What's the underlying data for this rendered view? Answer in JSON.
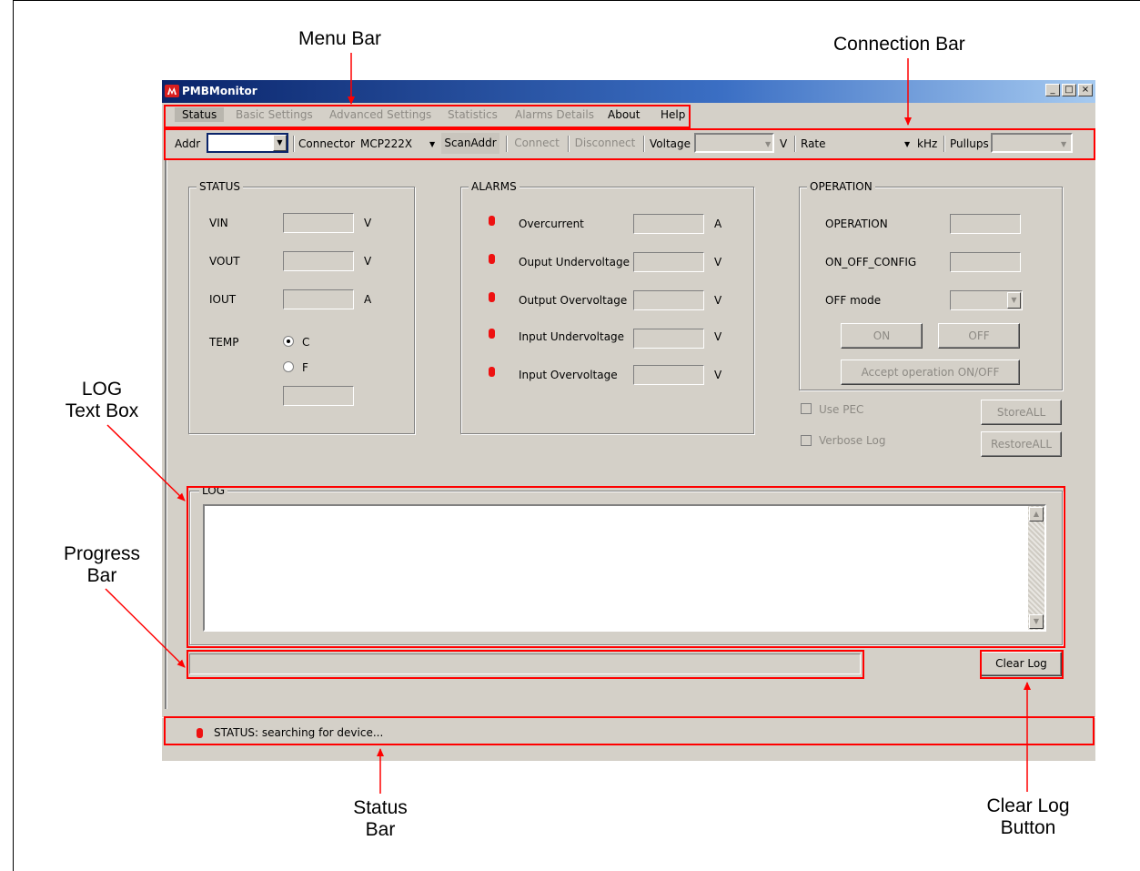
{
  "annotations": {
    "menu_bar": "Menu Bar",
    "connection_bar": "Connection Bar",
    "log_text_box_1": "LOG",
    "log_text_box_2": "Text Box",
    "progress_bar_1": "Progress",
    "progress_bar_2": "Bar",
    "status_bar_1": "Status",
    "status_bar_2": "Bar",
    "clear_log_1": "Clear Log",
    "clear_log_2": "Button"
  },
  "window": {
    "title": "PMBMonitor",
    "btn_minimize": "_",
    "btn_maximize": "□",
    "btn_close": "×"
  },
  "menu": {
    "items": [
      {
        "label": "Status",
        "state": "selected"
      },
      {
        "label": "Basic Settings",
        "state": "disabled"
      },
      {
        "label": "Advanced Settings",
        "state": "disabled"
      },
      {
        "label": "Statistics",
        "state": "disabled"
      },
      {
        "label": "Alarms Details",
        "state": "disabled"
      },
      {
        "label": "About",
        "state": "enabled"
      },
      {
        "label": "Help",
        "state": "enabled"
      }
    ]
  },
  "connection": {
    "addr_label": "Addr",
    "addr_value": "",
    "connector_label": "Connector",
    "connector_value": "MCP222X",
    "scan_button": "ScanAddr",
    "connect_button": "Connect",
    "disconnect_button": "Disconnect",
    "voltage_label": "Voltage",
    "voltage_unit": "V",
    "rate_label": "Rate",
    "rate_unit": "kHz",
    "pullups_label": "Pullups",
    "arrow": "▼"
  },
  "status_group": {
    "title": "STATUS",
    "vin_label": "VIN",
    "vin_unit": "V",
    "vout_label": "VOUT",
    "vout_unit": "V",
    "iout_label": "IOUT",
    "iout_unit": "A",
    "temp_label": "TEMP",
    "temp_c": "C",
    "temp_f": "F"
  },
  "alarms_group": {
    "title": "ALARMS",
    "items": [
      {
        "label": "Overcurrent",
        "unit": "A"
      },
      {
        "label": "Ouput Undervoltage",
        "unit": "V"
      },
      {
        "label": "Output Overvoltage",
        "unit": "V"
      },
      {
        "label": "Input Undervoltage",
        "unit": "V"
      },
      {
        "label": "Input Overvoltage",
        "unit": "V"
      }
    ]
  },
  "operation_group": {
    "title": "OPERATION",
    "operation_label": "OPERATION",
    "on_off_config_label": "ON_OFF_CONFIG",
    "off_mode_label": "OFF mode",
    "on_button": "ON",
    "off_button": "OFF",
    "accept_button": "Accept operation ON/OFF"
  },
  "options": {
    "use_pec": "Use PEC",
    "verbose_log": "Verbose Log",
    "store_all": "StoreALL",
    "restore_all": "RestoreALL"
  },
  "log": {
    "title": "LOG",
    "content": "",
    "scroll_up": "▲",
    "scroll_down": "▼"
  },
  "progress": {
    "value": 0
  },
  "clear_log_button": "Clear Log",
  "status_bar": {
    "text": "STATUS: searching for device..."
  },
  "colors": {
    "led_red": "#ee1111",
    "highlight_red": "#ff0000",
    "window_face": "#d4d0c8",
    "titlebar_blue": "#0a246a"
  }
}
